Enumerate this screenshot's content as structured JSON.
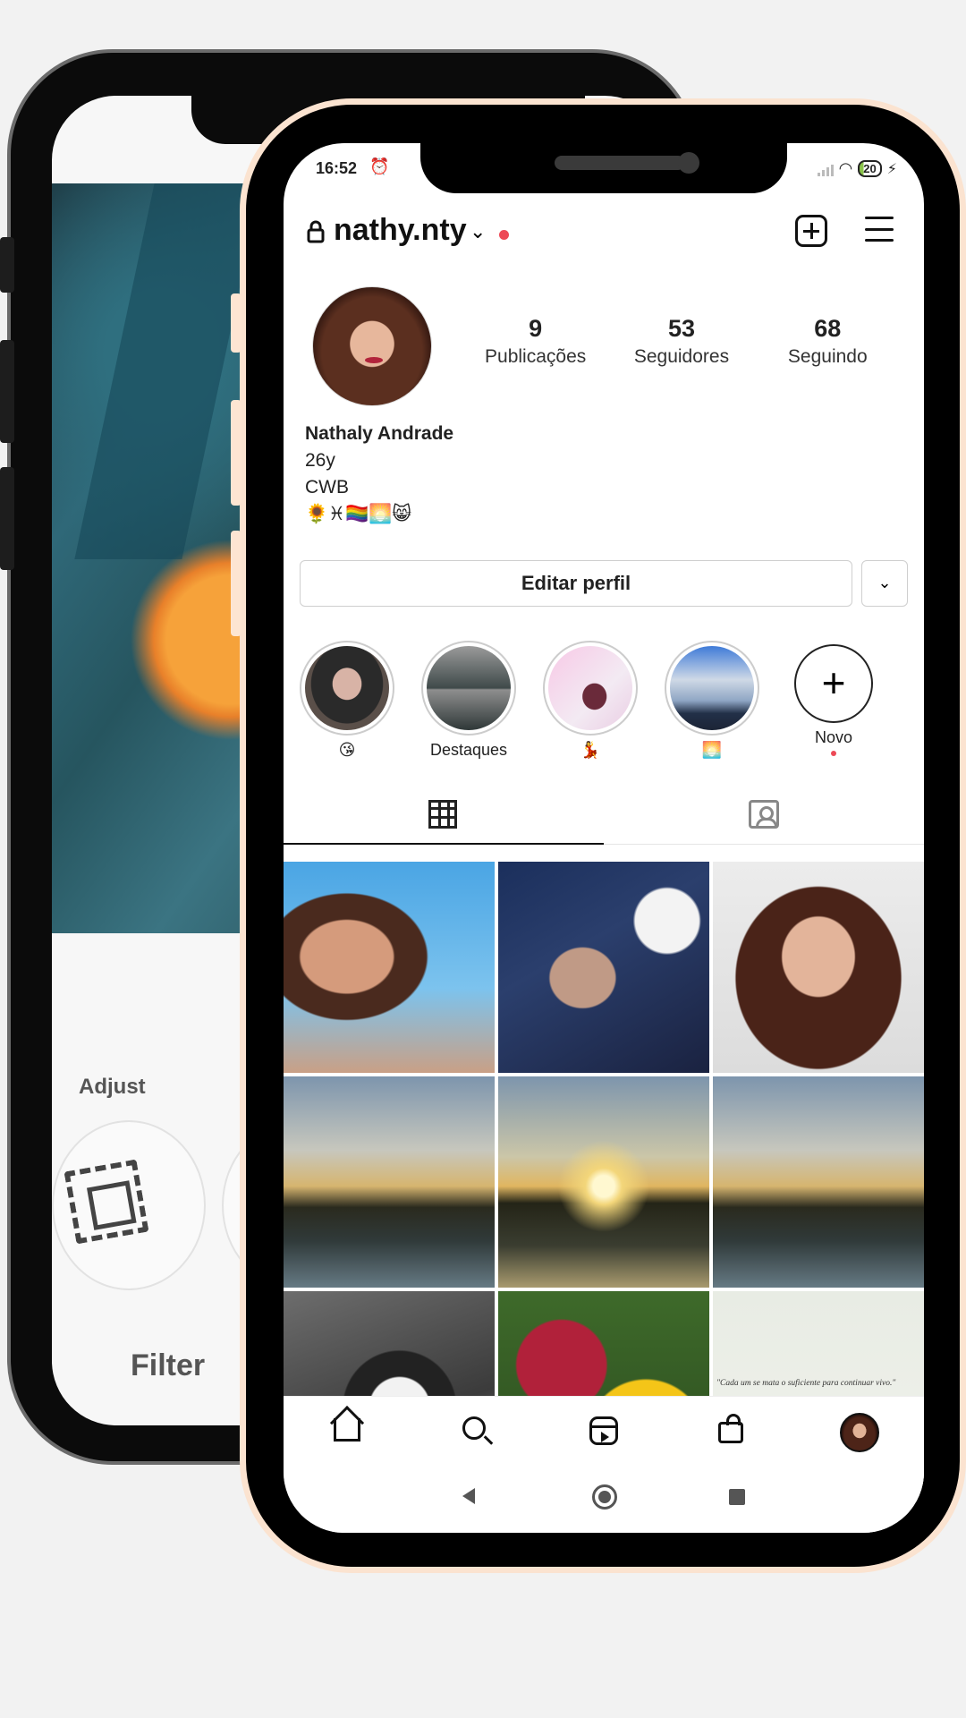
{
  "back_phone": {
    "adjust_label": "Adjust",
    "filter_label": "Filter"
  },
  "status_bar": {
    "time": "16:52",
    "battery": "20"
  },
  "header": {
    "username": "nathy.nty"
  },
  "profile": {
    "posts_count": "9",
    "posts_label": "Publicações",
    "followers_count": "53",
    "followers_label": "Seguidores",
    "following_count": "68",
    "following_label": "Seguindo",
    "name": "Nathaly Andrade",
    "bio_line1": "26y",
    "bio_line2": "CWB",
    "bio_emojis": "🌻♓🏳️‍🌈🌅😸",
    "edit_button": "Editar perfil"
  },
  "highlights": [
    {
      "label": "😘"
    },
    {
      "label": "Destaques"
    },
    {
      "label": "💃"
    },
    {
      "label": "🌅"
    },
    {
      "label": "Novo"
    }
  ],
  "grid": {
    "quote": "\"Cada um se mata o suficiente para continuar vivo.\""
  },
  "icons": {
    "lock": "lock-icon",
    "new_post": "plus-square-icon",
    "menu": "hamburger-icon",
    "grid_tab": "grid-icon",
    "tagged_tab": "person-tag-icon",
    "home": "home-icon",
    "search": "search-icon",
    "reels": "reels-icon",
    "shop": "shop-icon"
  },
  "colors": {
    "notification_dot": "#ed4956",
    "front_phone_rim": "#fbe3d0"
  }
}
